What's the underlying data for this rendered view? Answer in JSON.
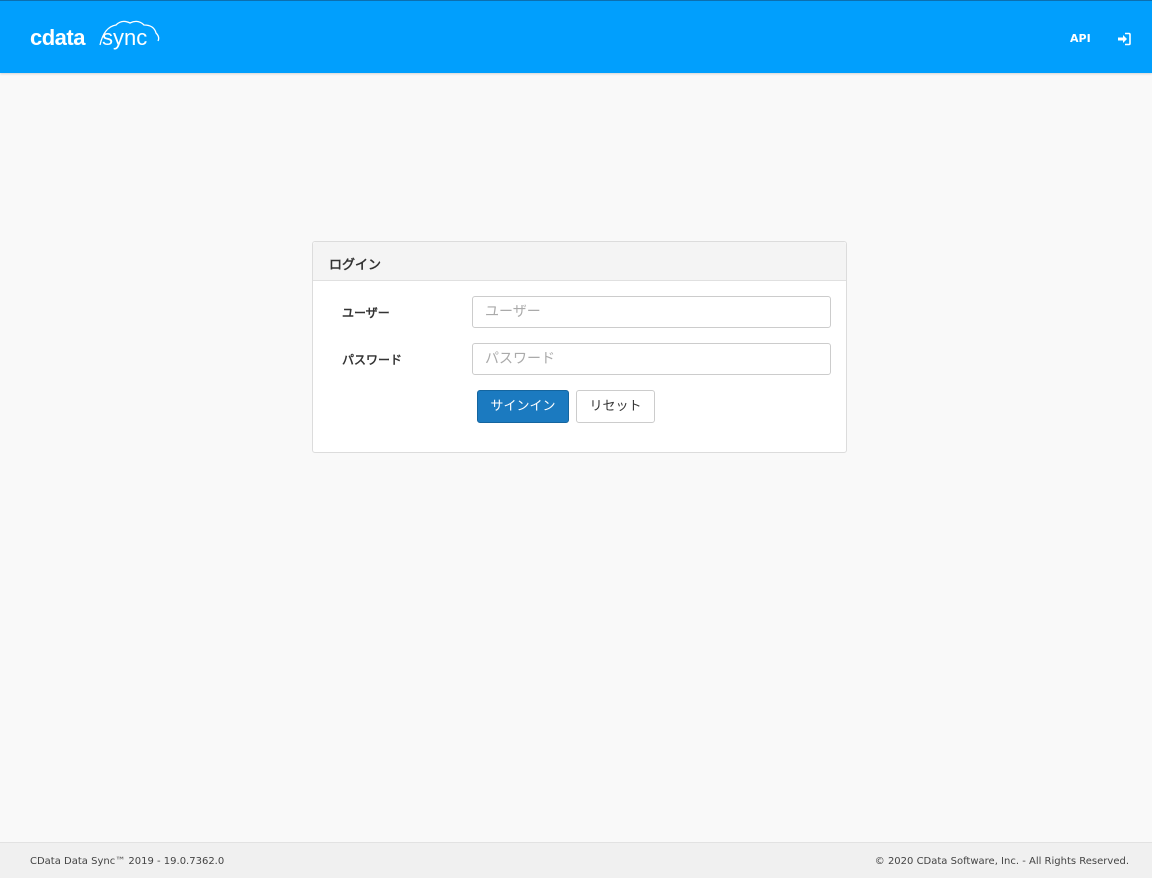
{
  "header": {
    "logo_text": "cdata sync",
    "nav_api": "API",
    "login_icon": "sign-in-icon",
    "bar_color": "#019ffd"
  },
  "login": {
    "title": "ログイン",
    "user_label": "ユーザー",
    "user_placeholder": "ユーザー",
    "user_value": "",
    "password_label": "パスワード",
    "password_placeholder": "パスワード",
    "password_value": "",
    "signin_label": "サインイン",
    "reset_label": "リセット",
    "primary_color": "#1b7ac0"
  },
  "footer": {
    "left": "CData Data Sync™ 2019 - 19.0.7362.0",
    "right": "© 2020 CData Software, Inc. - All Rights Reserved."
  }
}
